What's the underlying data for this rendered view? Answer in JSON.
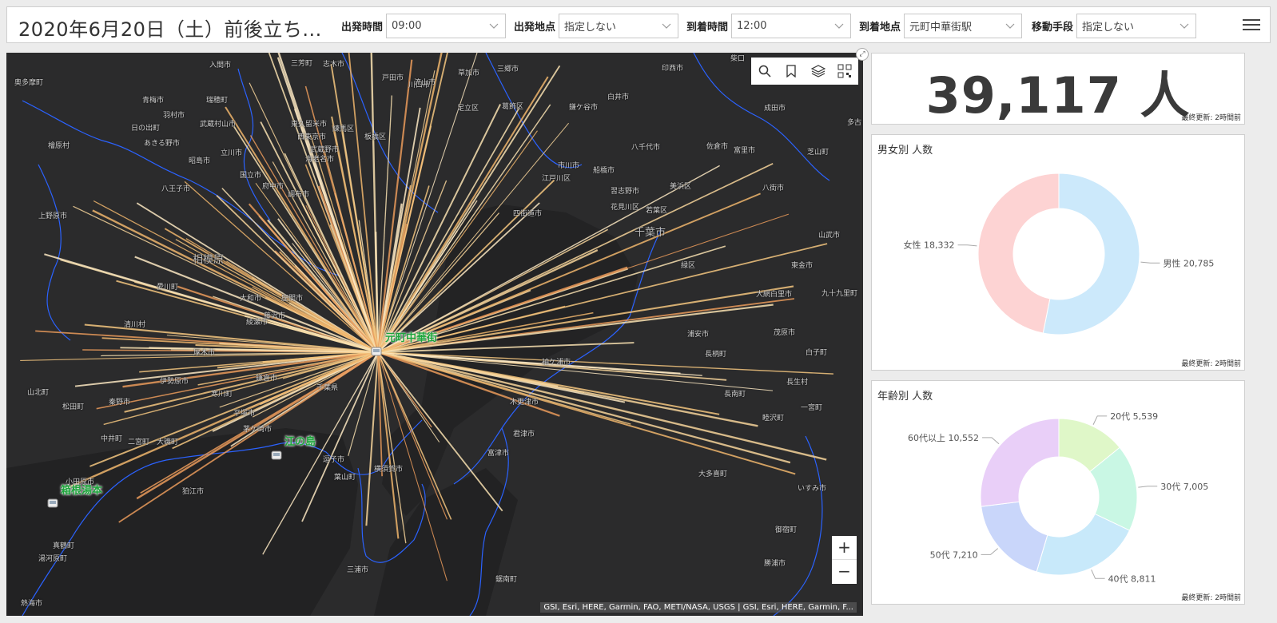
{
  "header": {
    "title": "2020年6月20日（土）前後立ち...",
    "filters": [
      {
        "label": "出発時間",
        "value": "09:00"
      },
      {
        "label": "出発地点",
        "value": "指定しない"
      },
      {
        "label": "到着時間",
        "value": "12:00"
      },
      {
        "label": "到着地点",
        "value": "元町中華街駅"
      },
      {
        "label": "移動手段",
        "value": "指定しない"
      }
    ]
  },
  "map": {
    "labels": [
      {
        "text": "奥多摩町"
      },
      {
        "text": "青梅市"
      },
      {
        "text": "羽村市"
      },
      {
        "text": "日の出町"
      },
      {
        "text": "檜原村"
      },
      {
        "text": "あきる野市"
      },
      {
        "text": "昭島市"
      },
      {
        "text": "八王子市"
      },
      {
        "text": "上野原市"
      },
      {
        "text": "相模原"
      },
      {
        "text": "愛川町"
      },
      {
        "text": "清川村"
      },
      {
        "text": "厚木市"
      },
      {
        "text": "伊勢原市"
      },
      {
        "text": "秦野市"
      },
      {
        "text": "松田町"
      },
      {
        "text": "山北町"
      },
      {
        "text": "中井町"
      },
      {
        "text": "真鶴町"
      },
      {
        "text": "湯河原町"
      },
      {
        "text": "熱海市"
      },
      {
        "text": "入間市"
      },
      {
        "text": "三芳町"
      },
      {
        "text": "志木市"
      },
      {
        "text": "戸田市"
      },
      {
        "text": "川口市"
      },
      {
        "text": "草加市"
      },
      {
        "text": "三郷市"
      },
      {
        "text": "柴口"
      },
      {
        "text": "印西市"
      },
      {
        "text": "白井市"
      },
      {
        "text": "鎌ケ谷市"
      },
      {
        "text": "成田市"
      },
      {
        "text": "八千代市"
      },
      {
        "text": "佐倉市"
      },
      {
        "text": "富里市"
      },
      {
        "text": "芝山町"
      },
      {
        "text": "八街市"
      },
      {
        "text": "山武市"
      },
      {
        "text": "東金市"
      },
      {
        "text": "大網白里市"
      },
      {
        "text": "九十九里町"
      },
      {
        "text": "千葉市"
      },
      {
        "text": "緑区"
      },
      {
        "text": "茂原市"
      },
      {
        "text": "長生村"
      },
      {
        "text": "長柄町"
      },
      {
        "text": "長南町"
      },
      {
        "text": "睦沢町"
      },
      {
        "text": "一宮町"
      },
      {
        "text": "大多喜町"
      },
      {
        "text": "いすみ市"
      },
      {
        "text": "御宿町"
      },
      {
        "text": "勝浦市"
      },
      {
        "text": "白子町"
      },
      {
        "text": "木更津市"
      },
      {
        "text": "袖ケ浦市"
      },
      {
        "text": "君津市"
      },
      {
        "text": "富津市"
      },
      {
        "text": "鋸南町"
      },
      {
        "text": "三浦市"
      },
      {
        "text": "葉山町"
      },
      {
        "text": "逗子市"
      },
      {
        "text": "横須賀市"
      },
      {
        "text": "平塚市"
      },
      {
        "text": "茅ケ崎市"
      },
      {
        "text": "寒川町"
      },
      {
        "text": "二宮町"
      },
      {
        "text": "大磯町"
      },
      {
        "text": "小田原市"
      },
      {
        "text": "国立市"
      },
      {
        "text": "府中市"
      },
      {
        "text": "調布市"
      },
      {
        "text": "立川市"
      },
      {
        "text": "武蔵村山市"
      },
      {
        "text": "瑞穂町"
      },
      {
        "text": "東久留米市"
      },
      {
        "text": "西東京市"
      },
      {
        "text": "武蔵野市"
      },
      {
        "text": "練馬区"
      },
      {
        "text": "板橋区"
      },
      {
        "text": "足立区"
      },
      {
        "text": "葛飾区"
      },
      {
        "text": "江戸川区"
      },
      {
        "text": "市川市"
      },
      {
        "text": "船橋市"
      },
      {
        "text": "習志野市"
      },
      {
        "text": "花見川区"
      },
      {
        "text": "美浜区"
      },
      {
        "text": "若葉区"
      },
      {
        "text": "四街道市"
      },
      {
        "text": "浦安市"
      },
      {
        "text": "千葉県"
      },
      {
        "text": "鎌倉市"
      },
      {
        "text": "藤沢市"
      },
      {
        "text": "大和市"
      },
      {
        "text": "座間市"
      },
      {
        "text": "綾瀬市"
      },
      {
        "text": "海老名市"
      },
      {
        "text": "狛江市"
      },
      {
        "text": "箱根湯本"
      },
      {
        "text": "元町中華街"
      },
      {
        "text": "江の島"
      },
      {
        "text": "流山市"
      },
      {
        "text": "多古"
      }
    ],
    "pois": {
      "main": "元町中華街",
      "enoshima": "江の島",
      "hakone": "箱根湯本"
    },
    "attribution": "GSI, Esri, HERE, Garmin, FAO, METI/NASA, USGS | GSI, Esri, HERE, Garmin, F...",
    "zoom_in": "+",
    "zoom_out": "−",
    "tools": [
      "search-icon",
      "bookmark-icon",
      "layers-icon",
      "qr-icon"
    ]
  },
  "total": {
    "value": "39,117 人",
    "updated": "最終更新: 2時間前"
  },
  "gender_panel": {
    "title": "男女別 人数",
    "updated": "最終更新: 2時間前"
  },
  "age_panel": {
    "title": "年齢別 人数",
    "updated": "最終更新: 2時間前"
  },
  "chart_data": [
    {
      "type": "pie",
      "title": "男女別 人数",
      "categories": [
        "男性",
        "女性"
      ],
      "values": [
        20785,
        18332
      ],
      "colors": [
        "#cce9fb",
        "#fdd3d3"
      ]
    },
    {
      "type": "pie",
      "title": "年齢別 人数",
      "categories": [
        "20代",
        "30代",
        "40代",
        "50代",
        "60代以上"
      ],
      "values": [
        5539,
        7005,
        8811,
        7210,
        10552
      ],
      "colors": [
        "#dff7c8",
        "#c9f7e4",
        "#c8e9fa",
        "#c9d6fa",
        "#e9cff8"
      ]
    }
  ]
}
